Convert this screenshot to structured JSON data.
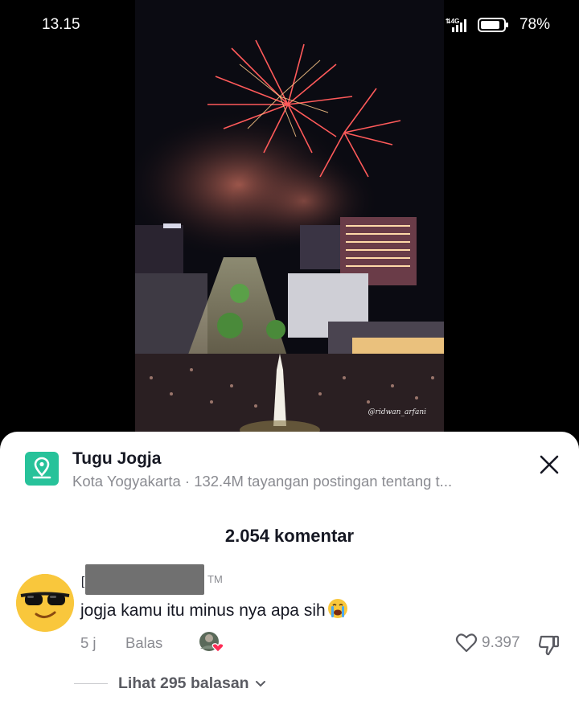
{
  "status_bar": {
    "time": "13.15",
    "battery": "78%",
    "network": "4G",
    "volte": "Vo LTE"
  },
  "video": {
    "watermark": "@ridwan_arfani"
  },
  "place": {
    "title": "Tugu Jogja",
    "subtitle": "Kota Yogyakarta · 132.4M tayangan postingan tentang t...",
    "icon": "location-pin-icon"
  },
  "comments": {
    "count_label": "2.054 komentar",
    "items": [
      {
        "username_visible_start": "[",
        "username_suffix": "TM",
        "text": "jogja kamu itu minus nya apa sih",
        "emoji": "crying-face-icon",
        "time": "5 j",
        "reply_label": "Balas",
        "likes": "9.397",
        "view_replies": "Lihat 295 balasan"
      }
    ]
  },
  "colors": {
    "accent_place": "#27c29a",
    "like_heart": "#fe2c55",
    "muted_text": "#8a8b91"
  }
}
